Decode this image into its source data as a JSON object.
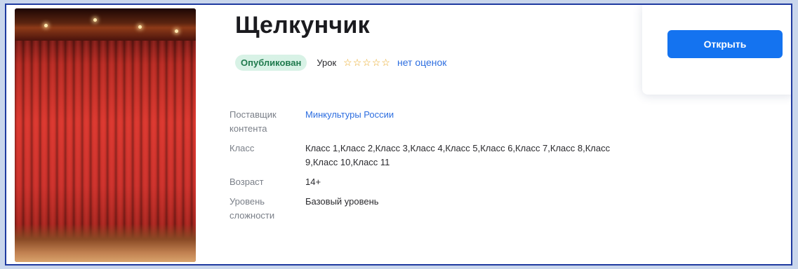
{
  "content": {
    "title": "Щелкунчик",
    "status_badge": "Опубликован",
    "type": "Урок",
    "stars": [
      "☆",
      "☆",
      "☆",
      "☆",
      "☆"
    ],
    "rating_text": "нет оценок",
    "open_button": "Открыть",
    "image_icon": "theater-curtain-image"
  },
  "details": {
    "provider_label": "Поставщик контента",
    "provider_value": "Минкультуры России",
    "class_label": "Класс",
    "class_value": "Класс 1,Класс 2,Класс 3,Класс 4,Класс 5,Класс 6,Класс 7,Класс 8,Класс 9,Класс 10,Класс 11",
    "age_label": "Возраст",
    "age_value": "14+",
    "level_label": "Уровень сложности",
    "level_value": "Базовый уровень"
  },
  "colors": {
    "accent": "#1473f0",
    "badge_bg": "#d8f2e6",
    "badge_text": "#1f7a4d",
    "star": "#e9a825",
    "link": "#2d6ee0"
  }
}
